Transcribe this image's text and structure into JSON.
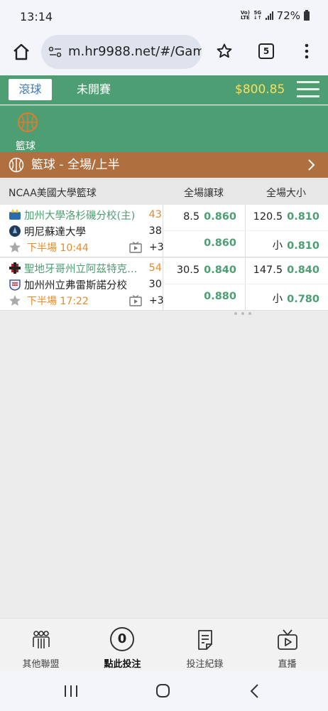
{
  "status_bar": {
    "time": "13:14",
    "network_top": "Vo)",
    "network_bottom": "LTE",
    "signal_label": "5G",
    "battery": "72%"
  },
  "browser": {
    "url": "m.hr9988.net/#/Gam",
    "tab_count": "5"
  },
  "app_header": {
    "tab_live": "滾球",
    "tab_upcoming": "未開賽",
    "balance": "$800.85"
  },
  "sport_filter": {
    "label": "籃球"
  },
  "section": {
    "title": "籃球 - 全場/上半"
  },
  "table_header": {
    "league": "NCAA美國大學籃球",
    "spread": "全場讓球",
    "total": "全場大小"
  },
  "matches": [
    {
      "home_team": "加州大學洛杉磯分校(主)",
      "home_score": "43",
      "away_team": "明尼蘇達大學",
      "away_score": "38",
      "period": "下半場 10:44",
      "more_markets": "+3",
      "spread_line": "8.5",
      "spread_home_price": "0.860",
      "spread_away_price": "0.860",
      "total_line": "120.5",
      "total_over_price": "0.810",
      "total_under_label": "小",
      "total_under_price": "0.810"
    },
    {
      "home_team": "聖地牙哥州立阿茲特克人隊",
      "home_score": "54",
      "away_team": "加州州立弗雷斯諾分校",
      "away_score": "30",
      "period": "下半場 17:22",
      "more_markets": "+3",
      "spread_line": "30.5",
      "spread_home_price": "0.840",
      "spread_away_price": "0.880",
      "total_line": "147.5",
      "total_over_price": "0.840",
      "total_under_label": "小",
      "total_under_price": "0.780"
    }
  ],
  "bottom_nav": {
    "other_leagues": "其他聯盟",
    "bet_count": "0",
    "place_bet": "點此投注",
    "bet_history": "投注紀錄",
    "live_stream": "直播"
  },
  "colors": {
    "header_green": "#4d9e72",
    "section_brown": "#b06f3e",
    "balance_yellow": "#f7e05a",
    "score_orange": "#e88a2a"
  }
}
